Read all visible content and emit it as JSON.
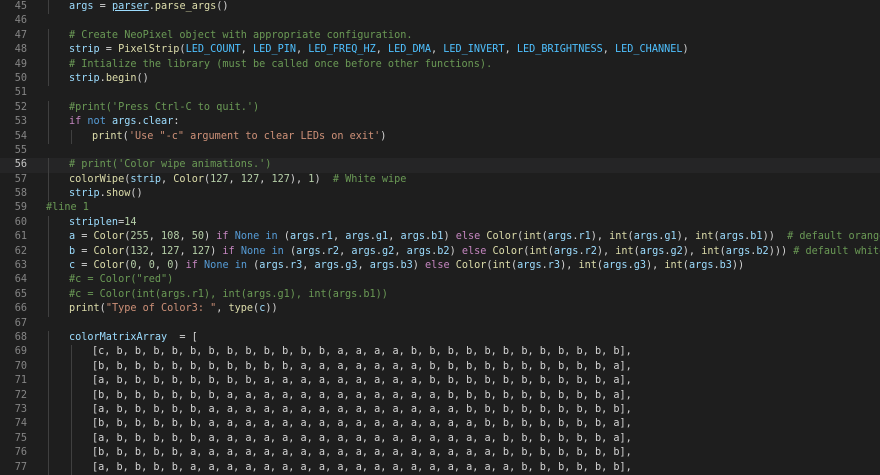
{
  "editor": {
    "current_line": 56,
    "lines": [
      {
        "n": "45",
        "indent": 1,
        "tokens": [
          [
            "var",
            "args"
          ],
          [
            "plain",
            " = "
          ],
          [
            "link",
            "parser"
          ],
          [
            "plain",
            "."
          ],
          [
            "fn",
            "parse_args"
          ],
          [
            "plain",
            "()"
          ]
        ]
      },
      {
        "n": "46",
        "indent": 0,
        "tokens": []
      },
      {
        "n": "47",
        "indent": 1,
        "tokens": [
          [
            "cmt",
            "# Create NeoPixel object with appropriate configuration."
          ]
        ]
      },
      {
        "n": "48",
        "indent": 1,
        "tokens": [
          [
            "var",
            "strip"
          ],
          [
            "plain",
            " = "
          ],
          [
            "fn",
            "PixelStrip"
          ],
          [
            "plain",
            "("
          ],
          [
            "const",
            "LED_COUNT"
          ],
          [
            "plain",
            ", "
          ],
          [
            "const",
            "LED_PIN"
          ],
          [
            "plain",
            ", "
          ],
          [
            "const",
            "LED_FREQ_HZ"
          ],
          [
            "plain",
            ", "
          ],
          [
            "const",
            "LED_DMA"
          ],
          [
            "plain",
            ", "
          ],
          [
            "const",
            "LED_INVERT"
          ],
          [
            "plain",
            ", "
          ],
          [
            "const",
            "LED_BRIGHTNESS"
          ],
          [
            "plain",
            ", "
          ],
          [
            "const",
            "LED_CHANNEL"
          ],
          [
            "plain",
            ")"
          ]
        ]
      },
      {
        "n": "49",
        "indent": 1,
        "tokens": [
          [
            "cmt",
            "# Intialize the library (must be called once before other functions)."
          ]
        ]
      },
      {
        "n": "50",
        "indent": 1,
        "tokens": [
          [
            "var",
            "strip"
          ],
          [
            "plain",
            "."
          ],
          [
            "fn",
            "begin"
          ],
          [
            "plain",
            "()"
          ]
        ]
      },
      {
        "n": "51",
        "indent": 0,
        "tokens": []
      },
      {
        "n": "52",
        "indent": 1,
        "tokens": [
          [
            "cmt",
            "#print('Press Ctrl-C to quit.')"
          ]
        ]
      },
      {
        "n": "53",
        "indent": 1,
        "tokens": [
          [
            "kw",
            "if"
          ],
          [
            "plain",
            " "
          ],
          [
            "kw2",
            "not"
          ],
          [
            "plain",
            " "
          ],
          [
            "var",
            "args"
          ],
          [
            "plain",
            "."
          ],
          [
            "var",
            "clear"
          ],
          [
            "plain",
            ":"
          ]
        ]
      },
      {
        "n": "54",
        "indent": 2,
        "tokens": [
          [
            "fn",
            "print"
          ],
          [
            "plain",
            "("
          ],
          [
            "str",
            "'Use \"-c\" argument to clear LEDs on exit'"
          ],
          [
            "plain",
            ")"
          ]
        ]
      },
      {
        "n": "55",
        "indent": 0,
        "tokens": []
      },
      {
        "n": "56",
        "indent": 1,
        "tokens": [
          [
            "cmt",
            "# print('Color wipe animations.')"
          ]
        ]
      },
      {
        "n": "57",
        "indent": 1,
        "tokens": [
          [
            "fn",
            "colorWipe"
          ],
          [
            "plain",
            "("
          ],
          [
            "var",
            "strip"
          ],
          [
            "plain",
            ", "
          ],
          [
            "fn",
            "Color"
          ],
          [
            "plain",
            "("
          ],
          [
            "num",
            "127"
          ],
          [
            "plain",
            ", "
          ],
          [
            "num",
            "127"
          ],
          [
            "plain",
            ", "
          ],
          [
            "num",
            "127"
          ],
          [
            "plain",
            "), "
          ],
          [
            "num",
            "1"
          ],
          [
            "plain",
            ")  "
          ],
          [
            "cmt",
            "# White wipe"
          ]
        ]
      },
      {
        "n": "58",
        "indent": 1,
        "tokens": [
          [
            "var",
            "strip"
          ],
          [
            "plain",
            "."
          ],
          [
            "fn",
            "show"
          ],
          [
            "plain",
            "()"
          ]
        ]
      },
      {
        "n": "59",
        "indent": 0,
        "tokens": [
          [
            "cmt",
            "#line 1"
          ]
        ]
      },
      {
        "n": "60",
        "indent": 1,
        "tokens": [
          [
            "var",
            "striplen"
          ],
          [
            "plain",
            "="
          ],
          [
            "num",
            "14"
          ]
        ]
      },
      {
        "n": "61",
        "indent": 1,
        "tokens": [
          [
            "var",
            "a"
          ],
          [
            "plain",
            " = "
          ],
          [
            "fn",
            "Color"
          ],
          [
            "plain",
            "("
          ],
          [
            "num",
            "255"
          ],
          [
            "plain",
            ", "
          ],
          [
            "num",
            "108"
          ],
          [
            "plain",
            ", "
          ],
          [
            "num",
            "50"
          ],
          [
            "plain",
            ") "
          ],
          [
            "kw",
            "if"
          ],
          [
            "plain",
            " "
          ],
          [
            "kw2",
            "None"
          ],
          [
            "plain",
            " "
          ],
          [
            "kw2",
            "in"
          ],
          [
            "plain",
            " ("
          ],
          [
            "var",
            "args"
          ],
          [
            "plain",
            "."
          ],
          [
            "var",
            "r1"
          ],
          [
            "plain",
            ", "
          ],
          [
            "var",
            "args"
          ],
          [
            "plain",
            "."
          ],
          [
            "var",
            "g1"
          ],
          [
            "plain",
            ", "
          ],
          [
            "var",
            "args"
          ],
          [
            "plain",
            "."
          ],
          [
            "var",
            "b1"
          ],
          [
            "plain",
            ") "
          ],
          [
            "kw",
            "else"
          ],
          [
            "plain",
            " "
          ],
          [
            "fn",
            "Color"
          ],
          [
            "plain",
            "("
          ],
          [
            "fn",
            "int"
          ],
          [
            "plain",
            "("
          ],
          [
            "var",
            "args"
          ],
          [
            "plain",
            "."
          ],
          [
            "var",
            "r1"
          ],
          [
            "plain",
            "), "
          ],
          [
            "fn",
            "int"
          ],
          [
            "plain",
            "("
          ],
          [
            "var",
            "args"
          ],
          [
            "plain",
            "."
          ],
          [
            "var",
            "g1"
          ],
          [
            "plain",
            "), "
          ],
          [
            "fn",
            "int"
          ],
          [
            "plain",
            "("
          ],
          [
            "var",
            "args"
          ],
          [
            "plain",
            "."
          ],
          [
            "var",
            "b1"
          ],
          [
            "plain",
            "))  "
          ],
          [
            "cmt",
            "# default orange"
          ]
        ]
      },
      {
        "n": "62",
        "indent": 1,
        "tokens": [
          [
            "var",
            "b"
          ],
          [
            "plain",
            " = "
          ],
          [
            "fn",
            "Color"
          ],
          [
            "plain",
            "("
          ],
          [
            "num",
            "132"
          ],
          [
            "plain",
            ", "
          ],
          [
            "num",
            "127"
          ],
          [
            "plain",
            ", "
          ],
          [
            "num",
            "127"
          ],
          [
            "plain",
            ") "
          ],
          [
            "kw",
            "if"
          ],
          [
            "plain",
            " "
          ],
          [
            "kw2",
            "None"
          ],
          [
            "plain",
            " "
          ],
          [
            "kw2",
            "in"
          ],
          [
            "plain",
            " ("
          ],
          [
            "var",
            "args"
          ],
          [
            "plain",
            "."
          ],
          [
            "var",
            "r2"
          ],
          [
            "plain",
            ", "
          ],
          [
            "var",
            "args"
          ],
          [
            "plain",
            "."
          ],
          [
            "var",
            "g2"
          ],
          [
            "plain",
            ", "
          ],
          [
            "var",
            "args"
          ],
          [
            "plain",
            "."
          ],
          [
            "var",
            "b2"
          ],
          [
            "plain",
            ") "
          ],
          [
            "kw",
            "else"
          ],
          [
            "plain",
            " "
          ],
          [
            "fn",
            "Color"
          ],
          [
            "plain",
            "("
          ],
          [
            "fn",
            "int"
          ],
          [
            "plain",
            "("
          ],
          [
            "var",
            "args"
          ],
          [
            "plain",
            "."
          ],
          [
            "var",
            "r2"
          ],
          [
            "plain",
            "), "
          ],
          [
            "fn",
            "int"
          ],
          [
            "plain",
            "("
          ],
          [
            "var",
            "args"
          ],
          [
            "plain",
            "."
          ],
          [
            "var",
            "g2"
          ],
          [
            "plain",
            "), "
          ],
          [
            "fn",
            "int"
          ],
          [
            "plain",
            "("
          ],
          [
            "var",
            "args"
          ],
          [
            "plain",
            "."
          ],
          [
            "var",
            "b2"
          ],
          [
            "plain",
            "))) "
          ],
          [
            "cmt",
            "# default whiteish"
          ]
        ]
      },
      {
        "n": "63",
        "indent": 1,
        "tokens": [
          [
            "var",
            "c"
          ],
          [
            "plain",
            " = "
          ],
          [
            "fn",
            "Color"
          ],
          [
            "plain",
            "("
          ],
          [
            "num",
            "0"
          ],
          [
            "plain",
            ", "
          ],
          [
            "num",
            "0"
          ],
          [
            "plain",
            ", "
          ],
          [
            "num",
            "0"
          ],
          [
            "plain",
            ") "
          ],
          [
            "kw",
            "if"
          ],
          [
            "plain",
            " "
          ],
          [
            "kw2",
            "None"
          ],
          [
            "plain",
            " "
          ],
          [
            "kw2",
            "in"
          ],
          [
            "plain",
            " ("
          ],
          [
            "var",
            "args"
          ],
          [
            "plain",
            "."
          ],
          [
            "var",
            "r3"
          ],
          [
            "plain",
            ", "
          ],
          [
            "var",
            "args"
          ],
          [
            "plain",
            "."
          ],
          [
            "var",
            "g3"
          ],
          [
            "plain",
            ", "
          ],
          [
            "var",
            "args"
          ],
          [
            "plain",
            "."
          ],
          [
            "var",
            "b3"
          ],
          [
            "plain",
            ") "
          ],
          [
            "kw",
            "else"
          ],
          [
            "plain",
            " "
          ],
          [
            "fn",
            "Color"
          ],
          [
            "plain",
            "("
          ],
          [
            "fn",
            "int"
          ],
          [
            "plain",
            "("
          ],
          [
            "var",
            "args"
          ],
          [
            "plain",
            "."
          ],
          [
            "var",
            "r3"
          ],
          [
            "plain",
            "), "
          ],
          [
            "fn",
            "int"
          ],
          [
            "plain",
            "("
          ],
          [
            "var",
            "args"
          ],
          [
            "plain",
            "."
          ],
          [
            "var",
            "g3"
          ],
          [
            "plain",
            "), "
          ],
          [
            "fn",
            "int"
          ],
          [
            "plain",
            "("
          ],
          [
            "var",
            "args"
          ],
          [
            "plain",
            "."
          ],
          [
            "var",
            "b3"
          ],
          [
            "plain",
            "))"
          ]
        ]
      },
      {
        "n": "64",
        "indent": 1,
        "tokens": [
          [
            "cmt",
            "#c = Color(\"red\")"
          ]
        ]
      },
      {
        "n": "65",
        "indent": 1,
        "tokens": [
          [
            "cmt",
            "#c = Color(int(args.r1), int(args.g1), int(args.b1))"
          ]
        ]
      },
      {
        "n": "66",
        "indent": 1,
        "tokens": [
          [
            "fn",
            "print"
          ],
          [
            "plain",
            "("
          ],
          [
            "str",
            "\"Type of Color3: \""
          ],
          [
            "plain",
            ", "
          ],
          [
            "fn",
            "type"
          ],
          [
            "plain",
            "("
          ],
          [
            "var",
            "c"
          ],
          [
            "plain",
            "))"
          ]
        ]
      },
      {
        "n": "67",
        "indent": 0,
        "tokens": []
      },
      {
        "n": "68",
        "indent": 1,
        "tokens": [
          [
            "var",
            "colorMatrixArray"
          ],
          [
            "plain",
            "  = ["
          ]
        ]
      },
      {
        "n": "69",
        "indent": 2,
        "tokens": [
          [
            "plain",
            "[c, b, b, b, b, b, b, b, b, b, b, b, b, a, a, a, a, b, b, b, b, b, b, b, b, b, b, b, b],"
          ]
        ]
      },
      {
        "n": "70",
        "indent": 2,
        "tokens": [
          [
            "plain",
            "[b, b, b, b, b, b, b, b, b, b, b, a, a, a, a, a, a, a, b, b, b, b, b, b, b, b, b, b, a],"
          ]
        ]
      },
      {
        "n": "71",
        "indent": 2,
        "tokens": [
          [
            "plain",
            "[a, b, b, b, b, b, b, b, b, a, a, a, a, a, a, a, a, a, b, b, b, b, b, b, b, b, b, b, a],"
          ]
        ]
      },
      {
        "n": "72",
        "indent": 2,
        "tokens": [
          [
            "plain",
            "[b, b, b, b, b, b, b, a, a, a, a, a, a, a, a, a, a, a, a, b, b, b, b, b, b, b, b, b, a],"
          ]
        ]
      },
      {
        "n": "73",
        "indent": 2,
        "tokens": [
          [
            "plain",
            "[a, b, b, b, b, b, a, a, a, a, a, a, a, a, a, a, a, a, a, a, b, b, b, b, b, b, b, b, b],"
          ]
        ]
      },
      {
        "n": "74",
        "indent": 2,
        "tokens": [
          [
            "plain",
            "[b, b, b, b, b, b, a, a, a, a, a, a, a, a, a, a, a, a, a, a, a, b, b, b, b, b, b, b, a],"
          ]
        ]
      },
      {
        "n": "75",
        "indent": 2,
        "tokens": [
          [
            "plain",
            "[a, b, b, b, b, b, a, a, a, a, a, a, a, a, a, a, a, a, a, a, a, a, b, b, b, b, b, b, a],"
          ]
        ]
      },
      {
        "n": "76",
        "indent": 2,
        "tokens": [
          [
            "plain",
            "[b, b, b, b, b, a, a, a, a, a, a, a, a, a, a, a, a, a, a, a, a, a, b, b, b, b, b, b, b],"
          ]
        ]
      },
      {
        "n": "77",
        "indent": 2,
        "tokens": [
          [
            "plain",
            "[a, b, b, b, b, a, a, a, a, a, a, a, a, a, a, a, a, a, a, a, a, a, a, b, b, b, b, b, b],"
          ]
        ]
      }
    ]
  }
}
